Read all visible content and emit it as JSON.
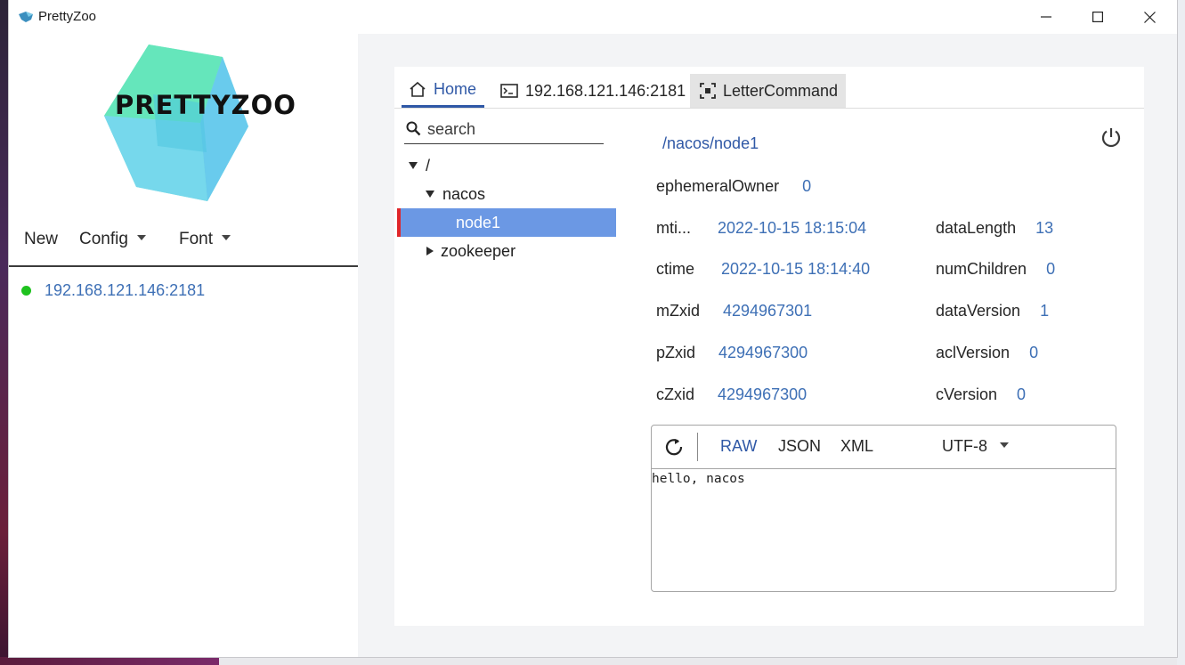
{
  "window": {
    "title": "PrettyZoo",
    "controls": [
      "minimize",
      "maximize",
      "close"
    ]
  },
  "logo": {
    "text": "PRETTYZOO"
  },
  "menu": {
    "new_label": "New",
    "config_label": "Config",
    "font_label": "Font"
  },
  "servers": [
    {
      "label": "192.168.121.146:2181",
      "status": "connected",
      "status_color": "#1fc21f"
    }
  ],
  "tabs": [
    {
      "label": "Home",
      "icon": "home-icon",
      "active": true
    },
    {
      "label": "192.168.121.146:2181",
      "icon": "terminal-icon",
      "active": false
    },
    {
      "label": "LetterCommand",
      "icon": "command-icon",
      "active": false
    }
  ],
  "tree": {
    "search_placeholder": "search",
    "nodes": [
      {
        "label": "/",
        "expanded": true
      },
      {
        "label": "nacos",
        "expanded": true
      },
      {
        "label": "node1",
        "selected": true
      },
      {
        "label": "zookeeper",
        "expanded": false
      }
    ]
  },
  "node": {
    "path": "/nacos/node1",
    "ephemeralOwner": {
      "label": "ephemeralOwner",
      "value": "0"
    },
    "mtime": {
      "label": "mti...",
      "value": "2022-10-15 18:15:04"
    },
    "ctime": {
      "label": "ctime",
      "value": "2022-10-15 18:14:40"
    },
    "mZxid": {
      "label": "mZxid",
      "value": "4294967301"
    },
    "pZxid": {
      "label": "pZxid",
      "value": "4294967300"
    },
    "cZxid": {
      "label": "cZxid",
      "value": "4294967300"
    },
    "dataLength": {
      "label": "dataLength",
      "value": "13"
    },
    "numChildren": {
      "label": "numChildren",
      "value": "0"
    },
    "dataVersion": {
      "label": "dataVersion",
      "value": "1"
    },
    "aclVersion": {
      "label": "aclVersion",
      "value": "0"
    },
    "cVersion": {
      "label": "cVersion",
      "value": "0"
    }
  },
  "editor": {
    "formats": [
      "RAW",
      "JSON",
      "XML"
    ],
    "active_format": "RAW",
    "encoding": "UTF-8",
    "content": "hello, nacos"
  },
  "colors": {
    "accent": "#2f58a6",
    "value_blue": "#3d6fb5",
    "selection": "#6b98e4",
    "selection_marker": "#e0262a"
  }
}
